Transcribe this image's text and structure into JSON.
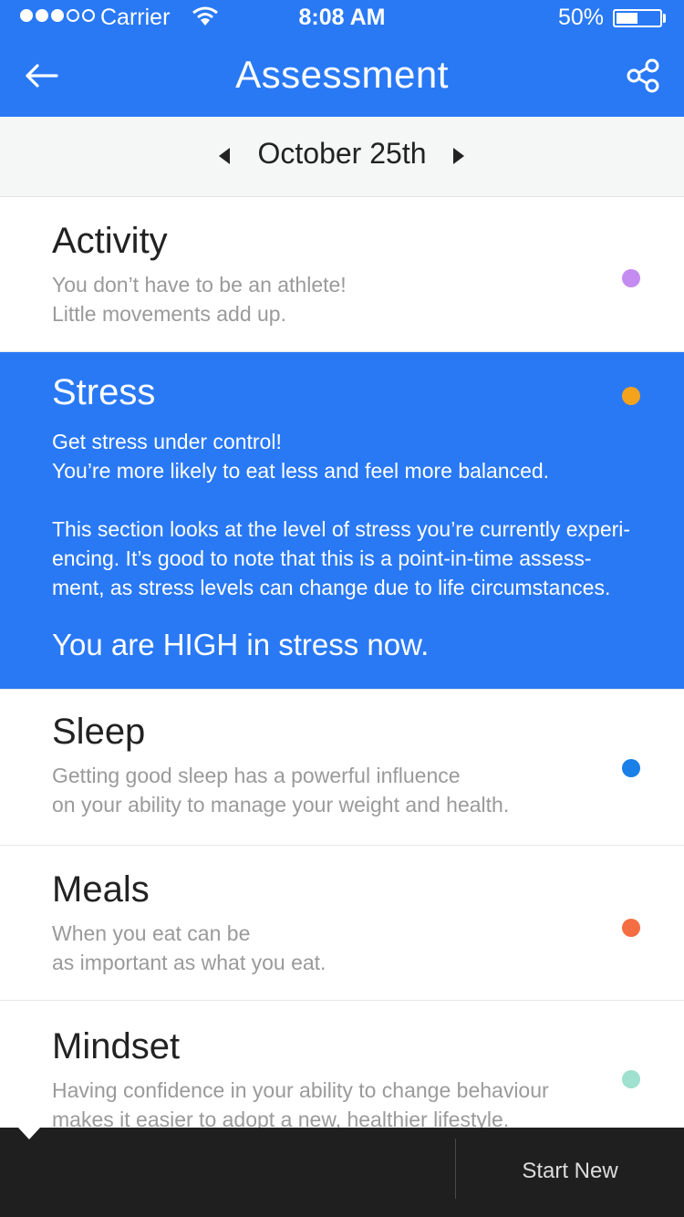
{
  "status_bar": {
    "carrier": "Carrier",
    "time": "8:08 AM",
    "battery_percent": "50%",
    "battery_level": 0.5,
    "signal_bars_filled": 3,
    "signal_bars_total": 5
  },
  "nav": {
    "title": "Assessment",
    "back_icon": "arrow-left-icon",
    "share_icon": "share-icon"
  },
  "date_bar": {
    "label": "October 25th",
    "prev_icon": "triangle-left-icon",
    "next_icon": "triangle-right-icon"
  },
  "sections": [
    {
      "id": "activity",
      "title": "Activity",
      "description": "You don’t have to be an athlete!\nLittle movements add up.",
      "dot_color": "#c48cf0"
    },
    {
      "id": "stress",
      "title": "Stress",
      "description": "Get stress under control!\nYou’re more likely to eat less and feel more balanced.",
      "detail": "This section looks at the level of stress you’re currently experi-\nencing. It’s good to note that this is a point-in-time assess-\nment, as stress levels can change due to life circumstances.",
      "verdict": "You are HIGH in stress now.",
      "dot_color": "#f5a21d",
      "expanded": true
    },
    {
      "id": "sleep",
      "title": "Sleep",
      "description": "Getting good sleep has a powerful influence\non your ability to manage your weight and  health.",
      "dot_color": "#1a7fe6"
    },
    {
      "id": "meals",
      "title": "Meals",
      "description": "When you eat can be\nas important as what you eat.",
      "dot_color": "#f46d43"
    },
    {
      "id": "mindset",
      "title": "Mindset",
      "description": "Having confidence in your ability to change behaviour\nmakes it easier to adopt a new, healthier lifestyle.",
      "dot_color": "#9fe0ce"
    }
  ],
  "footer": {
    "start_new_label": "Start New"
  },
  "colors": {
    "primary": "#2979f5",
    "footer_bg": "#1f1f1f"
  }
}
